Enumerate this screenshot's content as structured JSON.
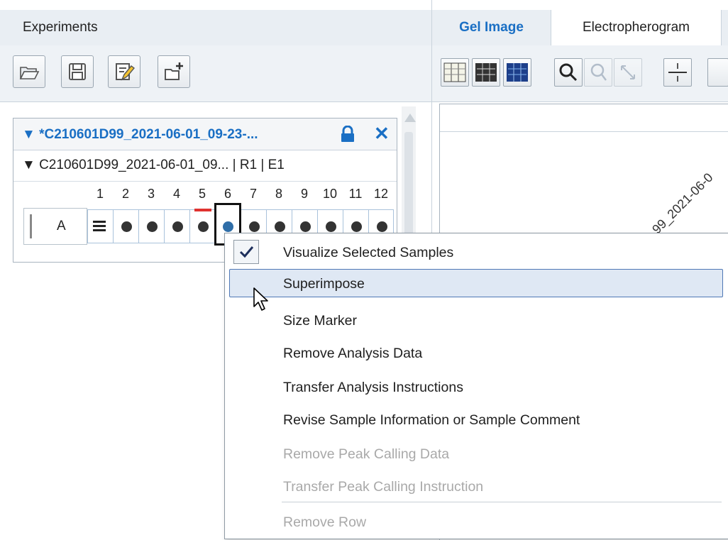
{
  "left_panel": {
    "title": "Experiments",
    "toolbar": [
      {
        "icon": "open-folder-icon"
      },
      {
        "icon": "save-icon"
      },
      {
        "icon": "edit-document-icon"
      },
      {
        "icon": "new-folder-icon"
      }
    ],
    "experiment": {
      "title": "▼ *C210601D99_2021-06-01_09-23-...",
      "lock_icon": "lock-icon",
      "close_label": "✕",
      "run_label": "▼ C210601D99_2021-06-01_09... | R1 | E1",
      "columns": [
        "1",
        "2",
        "3",
        "4",
        "5",
        "6",
        "7",
        "8",
        "9",
        "10",
        "11",
        "12"
      ],
      "row_label": "A",
      "selected_column": "6",
      "flagged_column": "5"
    }
  },
  "right_panel": {
    "tabs": [
      {
        "label": "Gel Image",
        "active": true
      },
      {
        "label": "Electropherogram",
        "active": false
      }
    ],
    "rotated_label": "99_2021-06-0"
  },
  "context_menu": {
    "items": [
      {
        "label": "Visualize Selected Samples",
        "checked": true,
        "enabled": true
      },
      {
        "label": "Superimpose",
        "hovered": true,
        "enabled": true
      },
      {
        "label": "Size Marker",
        "enabled": true
      },
      {
        "label": "Remove Analysis Data",
        "enabled": true
      },
      {
        "label": "Transfer Analysis Instructions",
        "enabled": true
      },
      {
        "label": "Revise Sample Information or Sample Comment",
        "enabled": true
      },
      {
        "label": "Remove Peak Calling Data",
        "enabled": false
      },
      {
        "label": "Transfer Peak Calling Instruction",
        "enabled": false
      },
      {
        "label": "Remove Row",
        "enabled": false
      }
    ],
    "check_mark": "✓"
  },
  "colors": {
    "accent": "#1a6fc4",
    "header_bg": "#e9eef3",
    "flag_red": "#e0322f",
    "hover_bg": "#dfe8f4"
  }
}
